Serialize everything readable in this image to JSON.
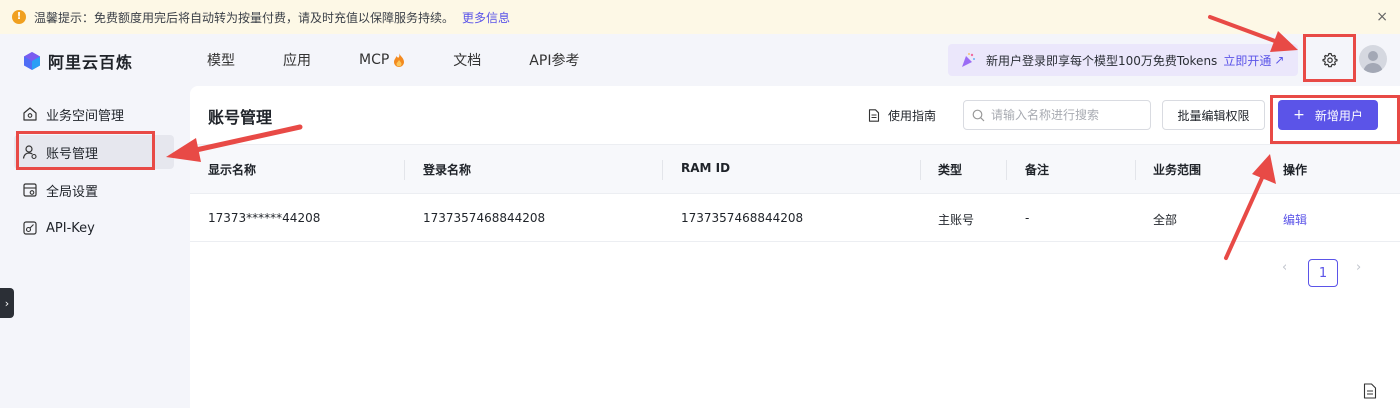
{
  "notice": {
    "text": "温馨提示：免费额度用完后将自动转为按量付费，请及时充值以保障服务持续。",
    "more_link": "更多信息",
    "close": "×",
    "icon": "warning-icon"
  },
  "header": {
    "logo_text": "阿里云百炼",
    "tabs": [
      {
        "label": "模型"
      },
      {
        "label": "应用"
      },
      {
        "label": "MCP"
      },
      {
        "label": "文档"
      },
      {
        "label": "API参考"
      }
    ],
    "promo_text": "新用户登录即享每个模型100万免费Tokens",
    "promo_link": "立即开通",
    "promo_link_icon": "↗",
    "settings_icon": "gear-icon",
    "avatar_icon": "user-avatar"
  },
  "sidebar": {
    "items": [
      {
        "label": "业务空间管理",
        "icon": "workspace-icon"
      },
      {
        "label": "账号管理",
        "icon": "user-icon",
        "active": true
      },
      {
        "label": "全局设置",
        "icon": "settings-icon"
      },
      {
        "label": "API-Key",
        "icon": "key-icon"
      }
    ],
    "expander": "›"
  },
  "main": {
    "title": "账号管理",
    "guide_label": "使用指南",
    "search_placeholder": "请输入名称进行搜索",
    "batch_button": "批量编辑权限",
    "add_button": "新增用户",
    "add_icon": "+",
    "columns": [
      "显示名称",
      "登录名称",
      "RAM ID",
      "类型",
      "备注",
      "业务范围",
      "操作"
    ],
    "rows": [
      {
        "display_name": "17373******44208",
        "login_name": "1737357468844208",
        "ram_id": "1737357468844208",
        "type": "主账号",
        "remark": "-",
        "scope": "全部",
        "action": "编辑"
      }
    ],
    "pagination": {
      "prev": "‹",
      "current": "1",
      "next": "›"
    }
  },
  "colors": {
    "accent": "#5b54e8",
    "highlight": "#e84a46",
    "notice_bg": "#fdf8e6"
  }
}
